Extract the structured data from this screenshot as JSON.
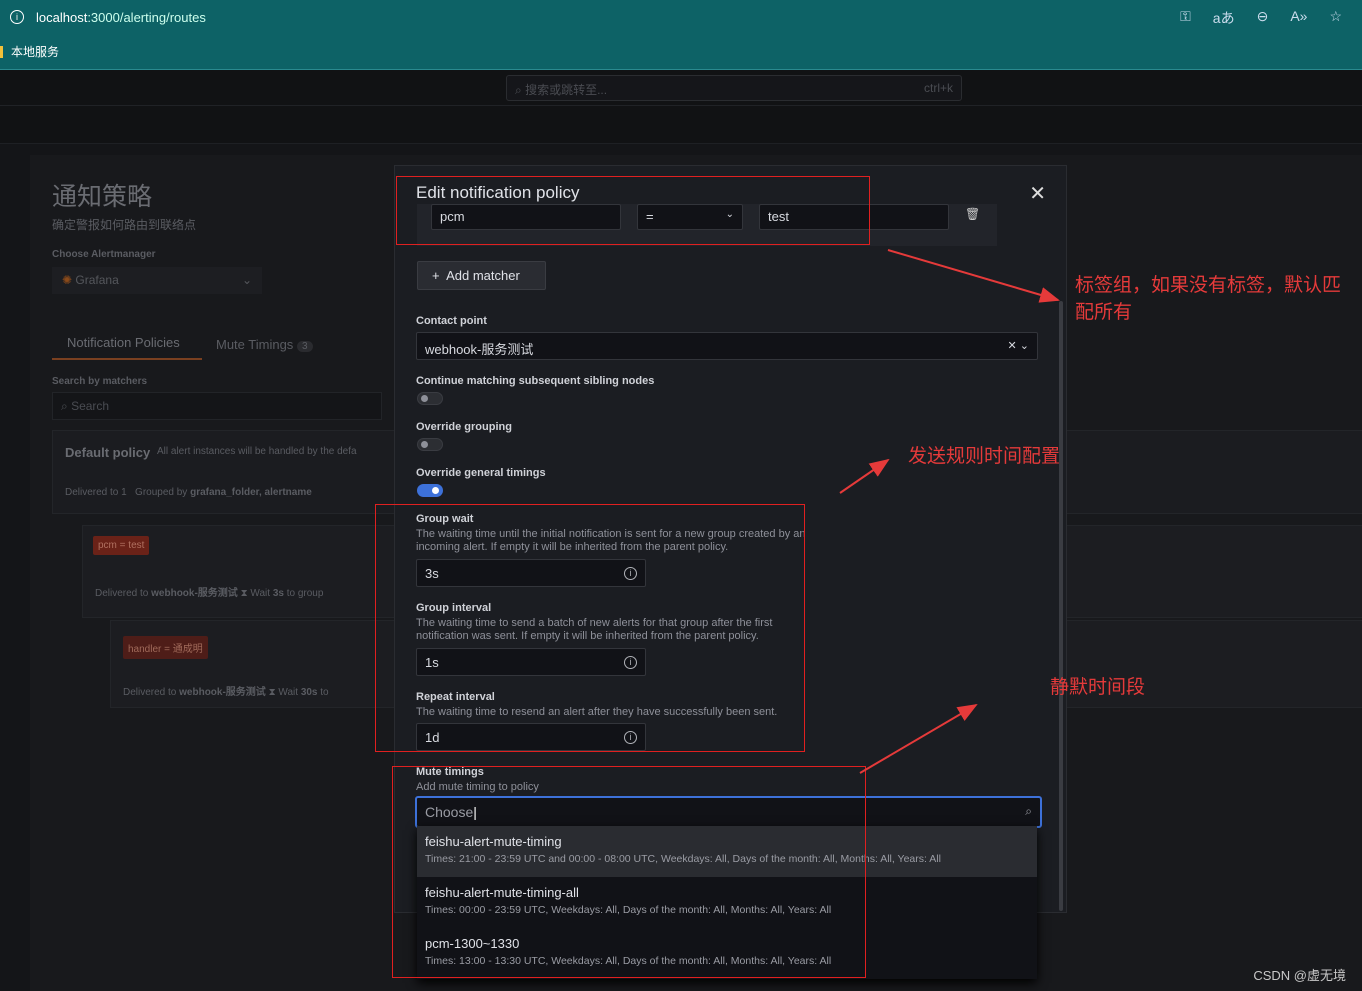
{
  "browser": {
    "url_host": "localhost",
    "url_path": ":3000/alerting/routes",
    "bookmark": "本地服务",
    "tool_icons": [
      "key-icon",
      "translate-icon",
      "zoom-out-icon",
      "read-aloud-icon",
      "star-icon"
    ]
  },
  "grafana": {
    "search_placeholder": "搜索或跳转至...",
    "search_shortcut": "ctrl+k"
  },
  "background": {
    "title": "通知策略",
    "subtitle": "确定警报如何路由到联络点",
    "am_label": "Choose Alertmanager",
    "am_value": "Grafana",
    "tabs": [
      {
        "label": "Notification Policies"
      },
      {
        "label": "Mute Timings",
        "count": "3"
      }
    ],
    "search_label": "Search by matchers",
    "search_placeholder": "Search",
    "default_policy": "Default policy",
    "default_desc": "All alert instances will be handled by the defa",
    "delivered_to": "Delivered to 1",
    "grouped_by": "Grouped by",
    "grouped_fields": "grafana_folder, alertname",
    "policy1_matcher": "pcm = test",
    "policy1_delivered": "Delivered to",
    "policy1_contact": "webhook-服务测试",
    "policy1_wait": "Wait",
    "policy1_wait_val": "3s",
    "policy1_wait_rest": "to group",
    "policy2_matcher": "handler = 通成明",
    "policy2_delivered": "Delivered to",
    "policy2_contact": "webhook-服务测试",
    "policy2_wait": "Wait",
    "policy2_wait_val": "30s",
    "policy2_wait_rest": "to"
  },
  "modal": {
    "title": "Edit notification policy",
    "matcher": {
      "label": "pcm",
      "operator": "=",
      "value": "test"
    },
    "add_matcher": "Add matcher",
    "contact_point_label": "Contact point",
    "contact_point_value": "webhook-服务测试",
    "continue_label": "Continue matching subsequent sibling nodes",
    "continue_on": false,
    "override_grouping_label": "Override grouping",
    "override_grouping_on": false,
    "override_timings_label": "Override general timings",
    "override_timings_on": true,
    "group_wait": {
      "label": "Group wait",
      "desc": "The waiting time until the initial notification is sent for a new group created by an incoming alert. If empty it will be inherited from the parent policy.",
      "value": "3s"
    },
    "group_interval": {
      "label": "Group interval",
      "desc": "The waiting time to send a batch of new alerts for that group after the first notification was sent. If empty it will be inherited from the parent policy.",
      "value": "1s"
    },
    "repeat_interval": {
      "label": "Repeat interval",
      "desc": "The waiting time to resend an alert after they have successfully been sent.",
      "value": "1d"
    },
    "mute_label": "Mute timings",
    "mute_desc": "Add mute timing to policy",
    "mute_placeholder": "Choose",
    "options": [
      {
        "title": "feishu-alert-mute-timing",
        "desc": "Times: 21:00 - 23:59 UTC and 00:00 - 08:00 UTC, Weekdays: All, Days of the month: All, Months: All, Years: All"
      },
      {
        "title": "feishu-alert-mute-timing-all",
        "desc": "Times: 00:00 - 23:59 UTC, Weekdays: All, Days of the month: All, Months: All, Years: All"
      },
      {
        "title": "pcm-1300~1330",
        "desc": "Times: 13:00 - 13:30 UTC, Weekdays: All, Days of the month: All, Months: All, Years: All"
      }
    ]
  },
  "annotations": {
    "labels": "标签组，如果没有标签，默认匹配所有",
    "timings": "发送规则时间配置",
    "mute": "静默时间段",
    "color": "#e53a3a"
  },
  "watermark": "CSDN @虚无境"
}
